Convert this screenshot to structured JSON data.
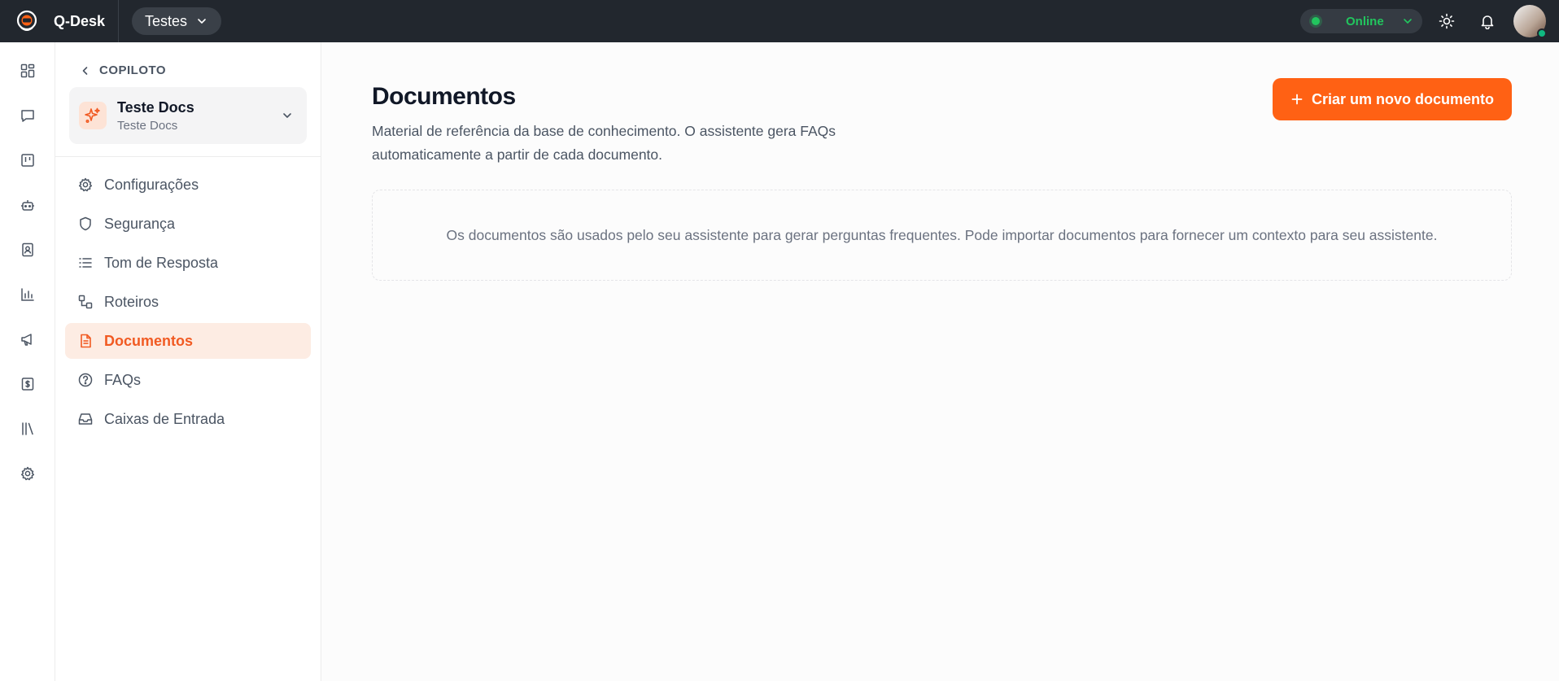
{
  "topbar": {
    "app_name": "Q-Desk",
    "workspace": "Testes",
    "status": "Online",
    "status_color": "#22c55e"
  },
  "rail": {
    "items": [
      {
        "icon": "dashboard-icon"
      },
      {
        "icon": "chat-icon"
      },
      {
        "icon": "kanban-icon"
      },
      {
        "icon": "bot-icon"
      },
      {
        "icon": "contacts-icon"
      },
      {
        "icon": "chart-icon"
      },
      {
        "icon": "megaphone-icon"
      },
      {
        "icon": "dollar-icon"
      },
      {
        "icon": "library-icon"
      },
      {
        "icon": "gear-icon"
      }
    ]
  },
  "sidebar": {
    "back_label": "COPILOTO",
    "assistant": {
      "name": "Teste Docs",
      "subtitle": "Teste Docs"
    },
    "items": [
      {
        "label": "Configurações",
        "icon": "gear-icon",
        "active": false
      },
      {
        "label": "Segurança",
        "icon": "shield-icon",
        "active": false
      },
      {
        "label": "Tom de Resposta",
        "icon": "list-icon",
        "active": false
      },
      {
        "label": "Roteiros",
        "icon": "workflow-icon",
        "active": false
      },
      {
        "label": "Documentos",
        "icon": "document-icon",
        "active": true
      },
      {
        "label": "FAQs",
        "icon": "help-circle-icon",
        "active": false
      },
      {
        "label": "Caixas de Entrada",
        "icon": "inbox-icon",
        "active": false
      }
    ]
  },
  "main": {
    "title": "Documentos",
    "description": "Material de referência da base de conhecimento. O assistente gera FAQs automaticamente a partir de cada documento.",
    "create_button": "Criar um novo documento",
    "empty_message": "Os documentos são usados pelo seu assistente para gerar perguntas frequentes. Pode importar documentos para fornecer um contexto para seu assistente."
  },
  "colors": {
    "accent": "#ff6114",
    "active_text": "#f15a22",
    "active_bg": "#fdece3",
    "topbar_bg": "#22272e"
  }
}
